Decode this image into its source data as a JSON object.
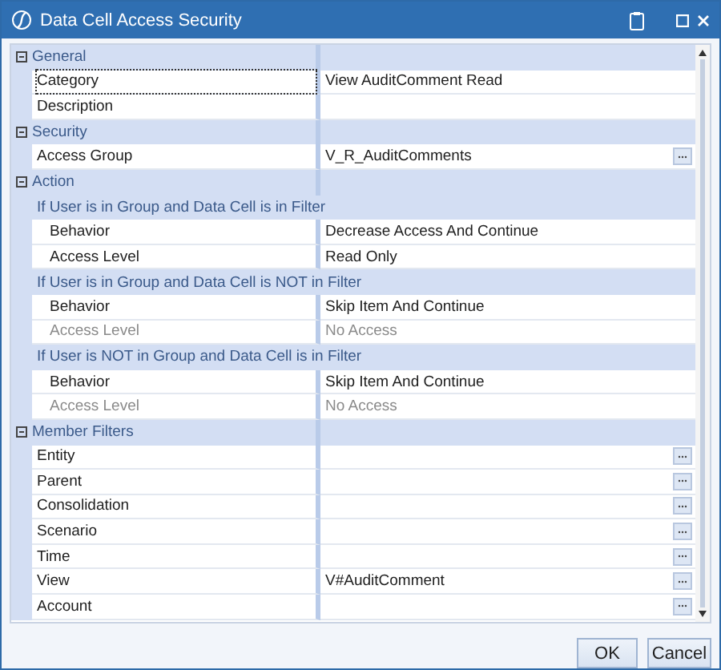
{
  "window": {
    "title": "Data Cell Access Security"
  },
  "sections": [
    {
      "title": "General",
      "expanded": true,
      "rows": [
        {
          "kind": "property",
          "label": "Category",
          "value": "View AuditComment Read",
          "selected": true,
          "disabled": false,
          "has_button": false
        },
        {
          "kind": "property",
          "label": "Description",
          "selected": false,
          "disabled": false,
          "has_button": false
        }
      ]
    },
    {
      "title": "Security",
      "expanded": true,
      "rows": [
        {
          "kind": "property",
          "label": "Access Group",
          "value": "V_R_AuditComments",
          "selected": false,
          "disabled": false,
          "has_button": true
        }
      ]
    },
    {
      "title": "Action",
      "expanded": true,
      "rows": [
        {
          "kind": "group",
          "label": "If User is in Group and Data Cell is in Filter",
          "children": [
            {
              "kind": "property",
              "label": "Behavior",
              "value": "Decrease Access And Continue",
              "selected": false,
              "disabled": false,
              "has_button": false
            },
            {
              "kind": "property",
              "label": "Access Level",
              "value": "Read Only",
              "selected": false,
              "disabled": false,
              "has_button": false
            }
          ]
        },
        {
          "kind": "group",
          "label": "If User is in Group and Data Cell is NOT in Filter",
          "children": [
            {
              "kind": "property",
              "label": "Behavior",
              "value": "Skip Item And Continue",
              "selected": false,
              "disabled": false,
              "has_button": false
            },
            {
              "kind": "property",
              "label": "Access Level",
              "value": "No Access",
              "selected": false,
              "disabled": true,
              "has_button": false
            }
          ]
        },
        {
          "kind": "group",
          "label": "If User is NOT in Group and Data Cell is in Filter",
          "children": [
            {
              "kind": "property",
              "label": "Behavior",
              "value": "Skip Item And Continue",
              "selected": false,
              "disabled": false,
              "has_button": false
            },
            {
              "kind": "property",
              "label": "Access Level",
              "value": "No Access",
              "selected": false,
              "disabled": true,
              "has_button": false
            }
          ]
        }
      ]
    },
    {
      "title": "Member Filters",
      "expanded": true,
      "rows": [
        {
          "kind": "property",
          "label": "Entity",
          "selected": false,
          "disabled": false,
          "has_button": true
        },
        {
          "kind": "property",
          "label": "Parent",
          "selected": false,
          "disabled": false,
          "has_button": true
        },
        {
          "kind": "property",
          "label": "Consolidation",
          "selected": false,
          "disabled": false,
          "has_button": true
        },
        {
          "kind": "property",
          "label": "Scenario",
          "selected": false,
          "disabled": false,
          "has_button": true
        },
        {
          "kind": "property",
          "label": "Time",
          "selected": false,
          "disabled": false,
          "has_button": true
        },
        {
          "kind": "property",
          "label": "View",
          "value": "V#AuditComment",
          "selected": false,
          "disabled": false,
          "has_button": true
        },
        {
          "kind": "property",
          "label": "Account",
          "selected": false,
          "disabled": false,
          "has_button": true
        }
      ]
    }
  ],
  "buttons": [
    "OK",
    "Cancel"
  ]
}
